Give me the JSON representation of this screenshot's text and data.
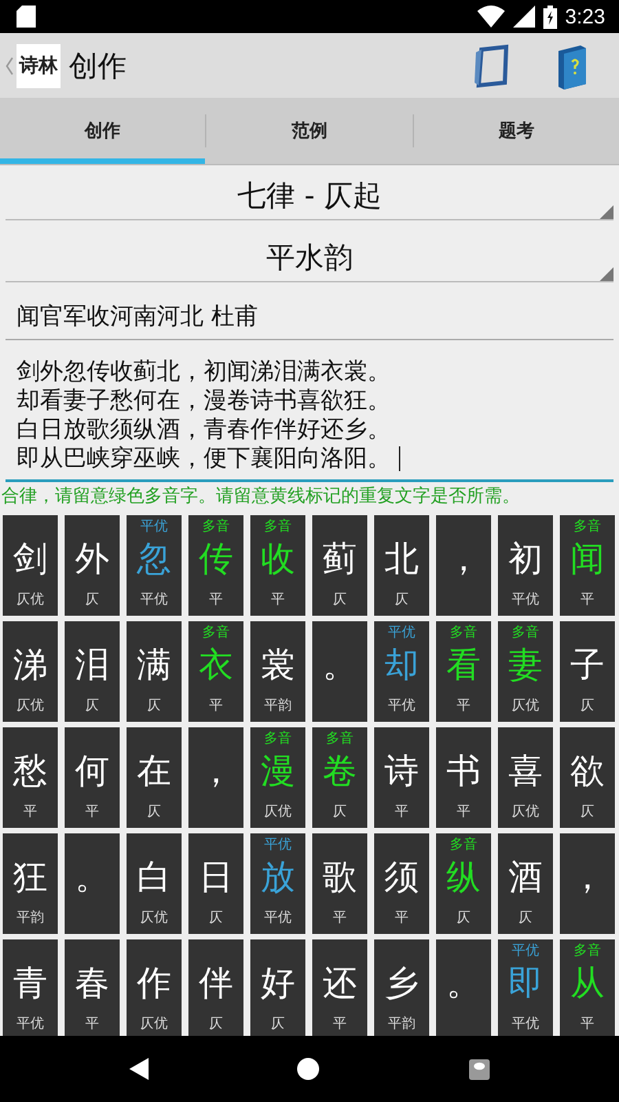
{
  "status_bar": {
    "time": "3:23"
  },
  "app_bar": {
    "logo": "诗林",
    "title": "创作"
  },
  "tabs": [
    {
      "label": "创作",
      "selected": true
    },
    {
      "label": "范例",
      "selected": false
    },
    {
      "label": "题考",
      "selected": false
    }
  ],
  "form_dropdown": {
    "value": "七律 - 仄起"
  },
  "rhyme_dropdown": {
    "value": "平水韵"
  },
  "title_field": {
    "value": "闻官军收河南河北 杜甫"
  },
  "poem_field": {
    "lines": [
      "剑外忽传收蓟北，初闻涕泪满衣裳。",
      "却看妻子愁何在，漫卷诗书喜欲狂。",
      "白日放歌须纵酒，青春作伴好还乡。",
      "即从巴峡穿巫峡，便下襄阳向洛阳。"
    ],
    "focused": true
  },
  "message": "合律，请留意绿色多音字。请留意黄线标记的重复文字是否所需。",
  "grid": [
    [
      {
        "char": "剑",
        "tone": "仄优",
        "kind": "plain"
      },
      {
        "char": "外",
        "tone": "仄",
        "kind": "plain"
      },
      {
        "char": "忽",
        "tone": "平优",
        "note": "平优",
        "kind": "preferred"
      },
      {
        "char": "传",
        "tone": "平",
        "note": "多音",
        "kind": "polyphone"
      },
      {
        "char": "收",
        "tone": "平",
        "note": "多音",
        "kind": "polyphone"
      },
      {
        "char": "蓟",
        "tone": "仄",
        "kind": "plain"
      },
      {
        "char": "北",
        "tone": "仄",
        "kind": "plain"
      },
      {
        "char": "，",
        "kind": "plain"
      },
      {
        "char": "初",
        "tone": "平优",
        "kind": "plain"
      },
      {
        "char": "闻",
        "tone": "平",
        "note": "多音",
        "kind": "polyphone"
      }
    ],
    [
      {
        "char": "涕",
        "tone": "仄优",
        "kind": "plain"
      },
      {
        "char": "泪",
        "tone": "仄",
        "kind": "plain"
      },
      {
        "char": "满",
        "tone": "仄",
        "kind": "plain"
      },
      {
        "char": "衣",
        "tone": "平",
        "note": "多音",
        "kind": "polyphone"
      },
      {
        "char": "裳",
        "tone": "平韵",
        "kind": "plain"
      },
      {
        "char": "。",
        "kind": "plain"
      },
      {
        "char": "却",
        "tone": "平优",
        "note": "平优",
        "kind": "preferred"
      },
      {
        "char": "看",
        "tone": "平",
        "note": "多音",
        "kind": "polyphone"
      },
      {
        "char": "妻",
        "tone": "仄优",
        "note": "多音",
        "kind": "polyphone"
      },
      {
        "char": "子",
        "tone": "仄",
        "kind": "plain"
      }
    ],
    [
      {
        "char": "愁",
        "tone": "平",
        "kind": "plain"
      },
      {
        "char": "何",
        "tone": "平",
        "kind": "plain"
      },
      {
        "char": "在",
        "tone": "仄",
        "kind": "plain"
      },
      {
        "char": "，",
        "kind": "plain"
      },
      {
        "char": "漫",
        "tone": "仄优",
        "note": "多音",
        "kind": "polyphone"
      },
      {
        "char": "卷",
        "tone": "仄",
        "note": "多音",
        "kind": "polyphone"
      },
      {
        "char": "诗",
        "tone": "平",
        "kind": "plain"
      },
      {
        "char": "书",
        "tone": "平",
        "kind": "plain"
      },
      {
        "char": "喜",
        "tone": "仄优",
        "kind": "plain"
      },
      {
        "char": "欲",
        "tone": "仄",
        "kind": "plain"
      }
    ],
    [
      {
        "char": "狂",
        "tone": "平韵",
        "kind": "plain"
      },
      {
        "char": "。",
        "kind": "plain"
      },
      {
        "char": "白",
        "tone": "仄优",
        "kind": "plain"
      },
      {
        "char": "日",
        "tone": "仄",
        "kind": "plain"
      },
      {
        "char": "放",
        "tone": "平优",
        "note": "平优",
        "kind": "preferred"
      },
      {
        "char": "歌",
        "tone": "平",
        "kind": "plain"
      },
      {
        "char": "须",
        "tone": "平",
        "kind": "plain"
      },
      {
        "char": "纵",
        "tone": "仄",
        "note": "多音",
        "kind": "polyphone"
      },
      {
        "char": "酒",
        "tone": "仄",
        "kind": "plain"
      },
      {
        "char": "，",
        "kind": "plain"
      }
    ],
    [
      {
        "char": "青",
        "tone": "平优",
        "kind": "plain"
      },
      {
        "char": "春",
        "tone": "平",
        "kind": "plain"
      },
      {
        "char": "作",
        "tone": "仄优",
        "kind": "plain"
      },
      {
        "char": "伴",
        "tone": "仄",
        "kind": "plain"
      },
      {
        "char": "好",
        "tone": "仄",
        "kind": "plain"
      },
      {
        "char": "还",
        "tone": "平",
        "kind": "plain"
      },
      {
        "char": "乡",
        "tone": "平韵",
        "kind": "plain"
      },
      {
        "char": "。",
        "kind": "plain"
      },
      {
        "char": "即",
        "tone": "平优",
        "note": "平优",
        "kind": "preferred"
      },
      {
        "char": "从",
        "tone": "平",
        "note": "多音",
        "kind": "polyphone"
      }
    ]
  ]
}
